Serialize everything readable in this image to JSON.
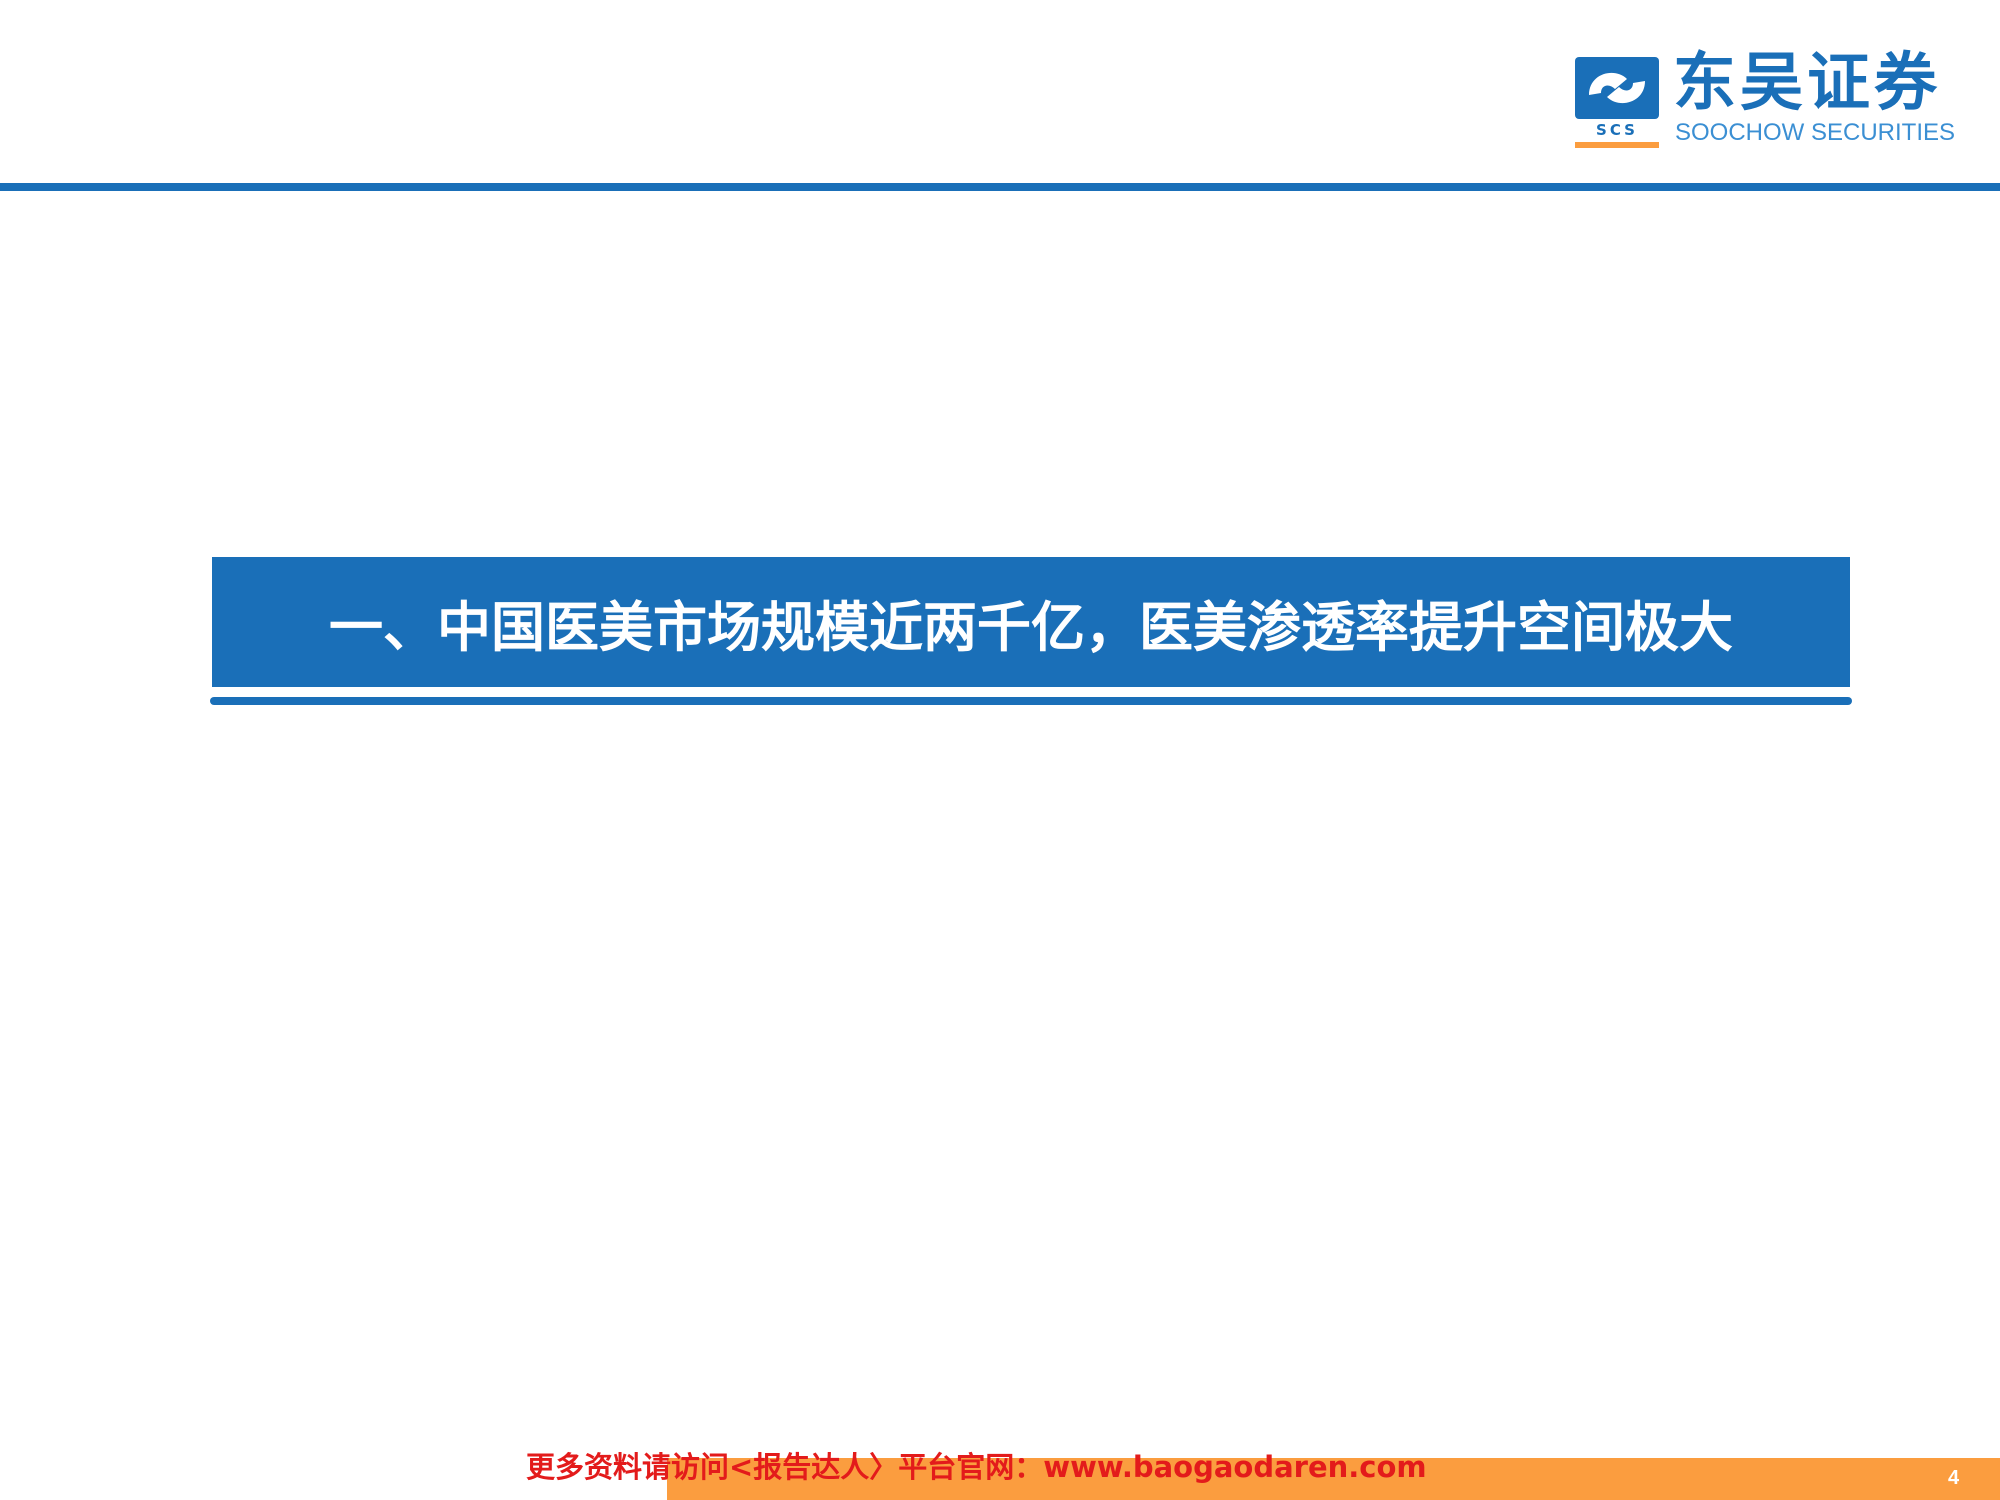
{
  "logo": {
    "name_cn": "东吴证券",
    "name_en": "SOOCHOW SECURITIES",
    "mark_text": "SCS",
    "icon": "soochow-securities-logo-icon"
  },
  "section": {
    "title": "一、中国医美市场规模近两千亿，医美渗透率提升空间极大"
  },
  "footer": {
    "notice": "更多资料请访问<报告达人〉平台官网：www.baogaodaren.com",
    "page_number": "4"
  },
  "colors": {
    "brand_blue": "#1a6fb8",
    "footer_orange": "#fb9d3f",
    "notice_red": "#e31b1b"
  }
}
